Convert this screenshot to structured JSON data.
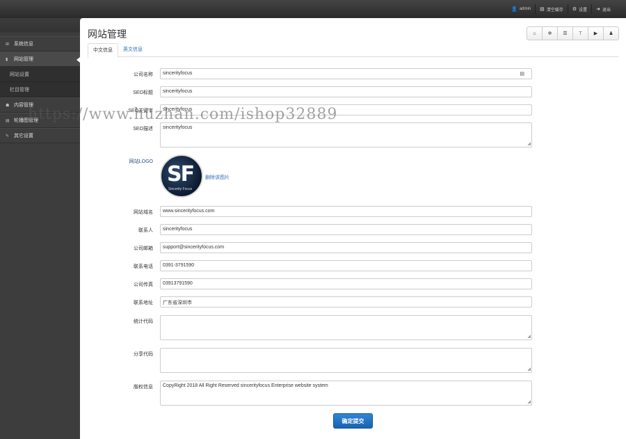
{
  "topbar": {
    "links": [
      {
        "icon": "user-icon",
        "glyph": "👤",
        "label": "admin"
      },
      {
        "icon": "cache-icon",
        "glyph": "▤",
        "label": "清空缓存"
      },
      {
        "icon": "gear-icon",
        "glyph": "⚙",
        "label": "设置"
      },
      {
        "icon": "logout-icon",
        "glyph": "➜",
        "label": "退出"
      }
    ]
  },
  "sidebar": {
    "items": [
      {
        "label": "系统信息",
        "icon": "grid-icon",
        "glyph": "⊞"
      },
      {
        "label": "网站管理",
        "icon": "page-icon",
        "glyph": "▮"
      },
      {
        "label": "网站设置"
      },
      {
        "label": "栏目管理"
      },
      {
        "label": "内容管理",
        "icon": "content-icon",
        "glyph": "☗"
      },
      {
        "label": "轮播图管理",
        "icon": "picture-icon",
        "glyph": "▤"
      },
      {
        "label": "其它设置",
        "icon": "wrench-icon",
        "glyph": "✎"
      }
    ]
  },
  "main": {
    "title": "网站管理",
    "toolbar": [
      {
        "icon": "home-icon",
        "glyph": "⌂"
      },
      {
        "icon": "settings-icon",
        "glyph": "✲"
      },
      {
        "icon": "list-icon",
        "glyph": "☰"
      },
      {
        "icon": "columns-icon",
        "glyph": "⊤"
      },
      {
        "icon": "video-icon",
        "glyph": "▶"
      },
      {
        "icon": "user-icon",
        "glyph": "♟"
      }
    ],
    "tabs": [
      "中文信息",
      "英文信息"
    ]
  },
  "form": {
    "company_name": {
      "label": "公司名称",
      "value": "sincerityfocus"
    },
    "seo_title": {
      "label": "SEO标题",
      "value": "sincerityfocus"
    },
    "seo_keywords": {
      "label": "SEO关键字",
      "value": "sincerityfocus"
    },
    "seo_desc": {
      "label": "SEO描述",
      "value": "sincerityfocus"
    },
    "logo": {
      "label": "网站LOGO",
      "logo_text": "SF",
      "logo_sub": "Sincerity Focus",
      "delete_label": "删除该图片"
    },
    "domain": {
      "label": "网站域名",
      "value": "www.sincerityfocus.com"
    },
    "contact": {
      "label": "联系人",
      "value": "sincerityfocus"
    },
    "email": {
      "label": "公司邮箱",
      "value": "support@sincerityfocus.com"
    },
    "phone": {
      "label": "联系电话",
      "value": "0391-3791590"
    },
    "fax": {
      "label": "公司传真",
      "value": "03913791590"
    },
    "address": {
      "label": "联系地址",
      "value": "广东省深圳市"
    },
    "stats_code": {
      "label": "统计代码",
      "value": ""
    },
    "share_code": {
      "label": "分享代码",
      "value": ""
    },
    "copyright": {
      "label": "版权信息",
      "value": "CopyRight 2018 All Right Reserved sincerityfocus Enterprise website system"
    },
    "submit_label": "确定提交"
  },
  "watermark": "https://www.huzhan.com/ishop32889"
}
